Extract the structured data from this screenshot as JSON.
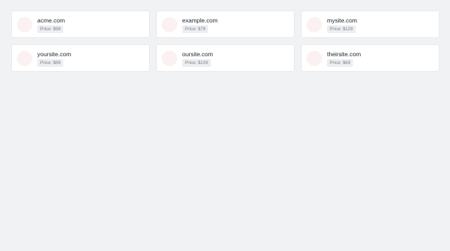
{
  "cards": [
    {
      "domain": "acme.com",
      "price": "Price: $99"
    },
    {
      "domain": "example.com",
      "price": "Price: $79"
    },
    {
      "domain": "mysite.com",
      "price": "Price: $129"
    },
    {
      "domain": "yoursite.com",
      "price": "Price: $89"
    },
    {
      "domain": "oursite.com",
      "price": "Price: $109"
    },
    {
      "domain": "theirsite.com",
      "price": "Price: $69"
    }
  ],
  "colors": {
    "background": "#f1f2f4",
    "card": "#ffffff",
    "avatar": "#fbf1f2",
    "badge": "#eceef1"
  }
}
